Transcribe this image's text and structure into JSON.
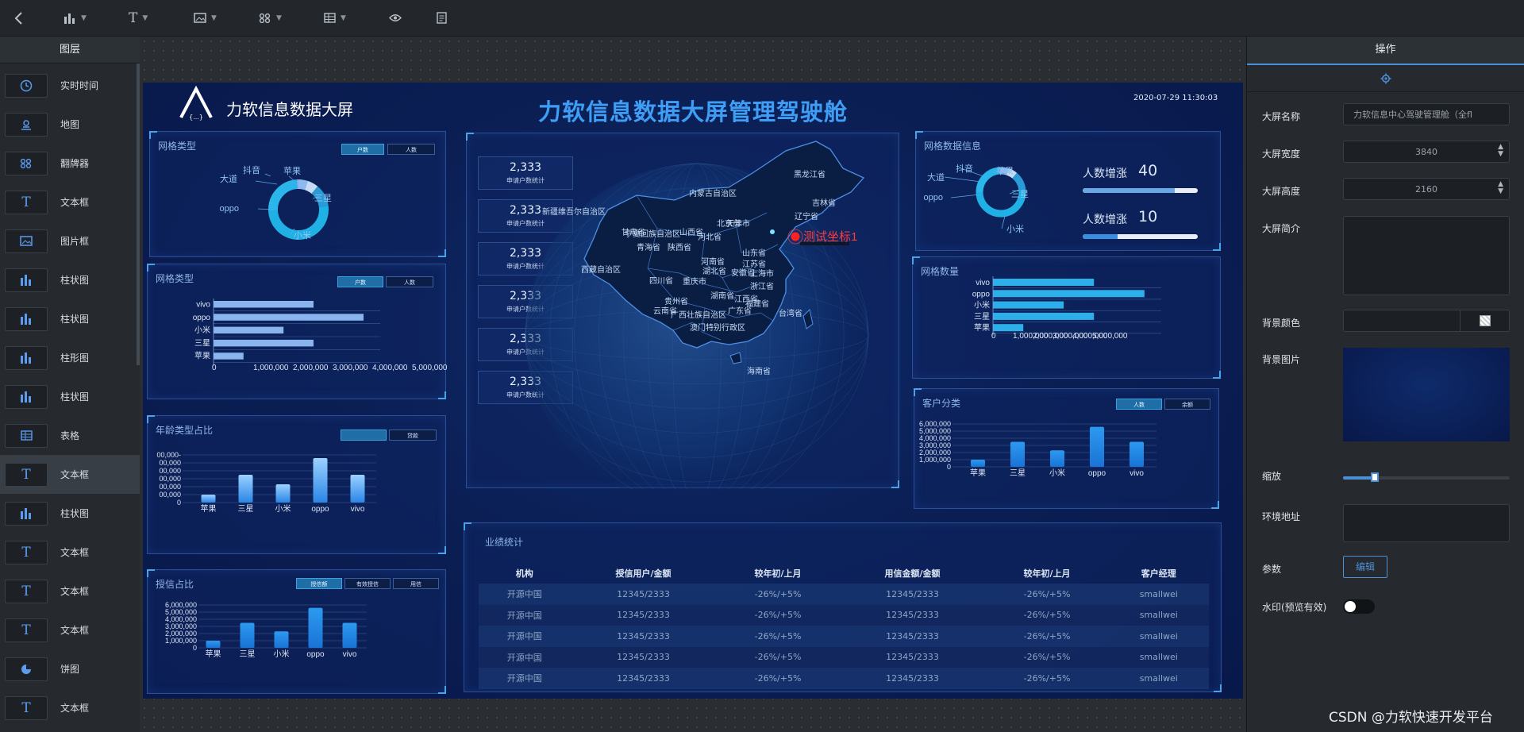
{
  "toolbar": {
    "icons": [
      "back-icon",
      "bar-chart-icon",
      "text-icon",
      "image-icon",
      "flipper-icon",
      "table-icon",
      "eye-icon",
      "document-icon"
    ]
  },
  "left_panel": {
    "title": "图层",
    "items": [
      {
        "label": "实时时间",
        "icon": "clock-icon"
      },
      {
        "label": "地图",
        "icon": "map-pin-icon"
      },
      {
        "label": "翻牌器",
        "icon": "flipper-icon"
      },
      {
        "label": "文本框",
        "icon": "text-icon"
      },
      {
        "label": "图片框",
        "icon": "image-icon"
      },
      {
        "label": "柱状图",
        "icon": "bar-chart-icon"
      },
      {
        "label": "柱状图",
        "icon": "bar-chart-icon"
      },
      {
        "label": "柱形图",
        "icon": "bar-chart-icon"
      },
      {
        "label": "柱状图",
        "icon": "bar-chart-icon"
      },
      {
        "label": "表格",
        "icon": "table-icon"
      },
      {
        "label": "文本框",
        "icon": "text-icon",
        "selected": true
      },
      {
        "label": "柱状图",
        "icon": "bar-chart-icon"
      },
      {
        "label": "文本框",
        "icon": "text-icon"
      },
      {
        "label": "文本框",
        "icon": "text-icon"
      },
      {
        "label": "文本框",
        "icon": "text-icon"
      },
      {
        "label": "饼图",
        "icon": "pie-chart-icon"
      },
      {
        "label": "文本框",
        "icon": "text-icon"
      }
    ]
  },
  "right_panel": {
    "title": "操作",
    "tab_icon": "gear-icon",
    "fields": {
      "name_label": "大屏名称",
      "name_value": "力软信息中心驾驶管理舱（全fl",
      "width_label": "大屏宽度",
      "width_value": "3840",
      "height_label": "大屏高度",
      "height_value": "2160",
      "intro_label": "大屏简介",
      "bgcolor_label": "背景颜色",
      "bgimage_label": "背景图片",
      "zoom_label": "缩放",
      "zoom_level": 0.19,
      "env_label": "环境地址",
      "params_label": "参数",
      "params_button": "编辑",
      "watermark_label": "水印(预览有效)",
      "watermark_on": false
    }
  },
  "dashboard": {
    "brand": "力软信息数据大屏",
    "logo_text": "{...}",
    "title": "力软信息数据大屏管理驾驶舱",
    "datetime": "2020-07-29 11:30:03",
    "map_marker": "测试坐标1",
    "map_labels": [
      "内蒙古自治区",
      "黑龙江省",
      "吉林省",
      "辽宁省",
      "新疆维吾尔自治区",
      "甘肃省",
      "宁夏回族自治区",
      "青海省",
      "陕西省",
      "山西省",
      "河北省",
      "北京市",
      "天津市",
      "山东省",
      "河南省",
      "西藏自治区",
      "四川省",
      "重庆市",
      "湖北省",
      "安徽省",
      "江苏省",
      "上海市",
      "浙江省",
      "湖南省",
      "江西省",
      "贵州省",
      "云南省",
      "广西壮族自治区",
      "广东省",
      "福建省",
      "台湾省",
      "澳门特别行政区",
      "海南省"
    ],
    "num_cards": [
      {
        "value": "2,333",
        "label": "申请户数统计"
      },
      {
        "value": "2,333",
        "label": "申请户数统计"
      },
      {
        "value": "2,333",
        "label": "申请户数统计"
      },
      {
        "value": "2,333",
        "label": "申请户数统计"
      },
      {
        "value": "2,333",
        "label": "申请户数统计"
      },
      {
        "value": "2,333",
        "label": "申请户数统计"
      }
    ],
    "pie1": {
      "title": "网格类型",
      "pills": [
        "户数",
        "人数"
      ]
    },
    "hbar1": {
      "title": "网格类型",
      "pills": [
        "户数",
        "人数"
      ]
    },
    "bar_age": {
      "title": "年龄类型占比",
      "pills": [
        "",
        "贷款"
      ]
    },
    "bar_credit": {
      "title": "授信占比",
      "pills": [
        "授信额",
        "有效授信",
        "用信"
      ]
    },
    "pie2": {
      "title": "网格数据信息",
      "stat1_label": "人数增涨",
      "stat1_value": "40",
      "stat1_fill": 0.8,
      "stat2_label": "人数增涨",
      "stat2_value": "10",
      "stat2_fill": 0.3
    },
    "hbar2": {
      "title": "网格数量"
    },
    "bar_customer": {
      "title": "客户分类",
      "pills": [
        "人数",
        "余额"
      ]
    },
    "table": {
      "title": "业绩统计",
      "headers": [
        "机构",
        "授信用户/金额",
        "较年初/上月",
        "用信金额/金额",
        "较年初/上月",
        "客户经理"
      ],
      "rows": [
        [
          "开源中国",
          "12345/2333",
          "-26%/+5%",
          "12345/2333",
          "-26%/+5%",
          "smallwei"
        ],
        [
          "开源中国",
          "12345/2333",
          "-26%/+5%",
          "12345/2333",
          "-26%/+5%",
          "smallwei"
        ],
        [
          "开源中国",
          "12345/2333",
          "-26%/+5%",
          "12345/2333",
          "-26%/+5%",
          "smallwei"
        ],
        [
          "开源中国",
          "12345/2333",
          "-26%/+5%",
          "12345/2333",
          "-26%/+5%",
          "smallwei"
        ],
        [
          "开源中国",
          "12345/2333",
          "-26%/+5%",
          "12345/2333",
          "-26%/+5%",
          "smallwei"
        ]
      ]
    }
  },
  "chart_data": [
    {
      "type": "pie",
      "id": "pie1",
      "categories": [
        "抖音",
        "苹果",
        "三星",
        "小米",
        "oppo",
        "大道"
      ],
      "values": [
        5,
        6,
        12,
        52,
        24,
        1
      ]
    },
    {
      "type": "bar",
      "id": "hbar1",
      "orientation": "horizontal",
      "categories": [
        "vivo",
        "oppo",
        "小米",
        "三星",
        "苹果"
      ],
      "values": [
        6000000,
        9000000,
        4200000,
        6000000,
        1800000
      ],
      "xlim": [
        0,
        10000000
      ],
      "xticks": [
        "0",
        "1,000,000",
        "2,000,000",
        "3,000,000",
        "4,000,000",
        "5,000,000"
      ]
    },
    {
      "type": "bar",
      "id": "bar_age",
      "categories": [
        "苹果",
        "三星",
        "小米",
        "oppo",
        "vivo"
      ],
      "values": [
        1000000,
        3500000,
        2300000,
        5600000,
        3500000
      ],
      "ylim": [
        0,
        6000000
      ],
      "yticks": [
        "0",
        "00,000",
        "00,000",
        "00,000",
        "00,000",
        "00,000",
        "00,000-"
      ]
    },
    {
      "type": "bar",
      "id": "bar_credit",
      "categories": [
        "苹果",
        "三星",
        "小米",
        "oppo",
        "vivo"
      ],
      "values": [
        1000000,
        3500000,
        2300000,
        5600000,
        3500000
      ],
      "ylim": [
        0,
        6000000
      ],
      "yticks": [
        "0",
        "1,000,000",
        "2,000,000",
        "3,000,000",
        "4,000,000",
        "5,000,000",
        "6,000,000"
      ]
    },
    {
      "type": "pie",
      "id": "pie2",
      "categories": [
        "抖音",
        "苹果",
        "三星",
        "小米",
        "oppo",
        "大道"
      ],
      "values": [
        5,
        6,
        12,
        52,
        24,
        1
      ]
    },
    {
      "type": "bar",
      "id": "hbar2",
      "orientation": "horizontal",
      "categories": [
        "vivo",
        "oppo",
        "小米",
        "三星",
        "苹果"
      ],
      "values": [
        6000000,
        9000000,
        4200000,
        6000000,
        1800000
      ],
      "xlim": [
        0,
        10000000
      ],
      "xticks": [
        "0",
        "1,000,000",
        "2,000,000",
        "3,000,000",
        "4,000,000",
        "5,000,000"
      ]
    },
    {
      "type": "bar",
      "id": "bar_customer",
      "categories": [
        "苹果",
        "三星",
        "小米",
        "oppo",
        "vivo"
      ],
      "values": [
        1000000,
        3500000,
        2300000,
        5600000,
        3500000
      ],
      "ylim": [
        0,
        6000000
      ],
      "yticks": [
        "0",
        "1,000,000",
        "2,000,000",
        "3,000,000",
        "4,000,000",
        "5,000,000",
        "6,000,000"
      ]
    }
  ],
  "watermark": "CSDN @力软快速开发平台"
}
